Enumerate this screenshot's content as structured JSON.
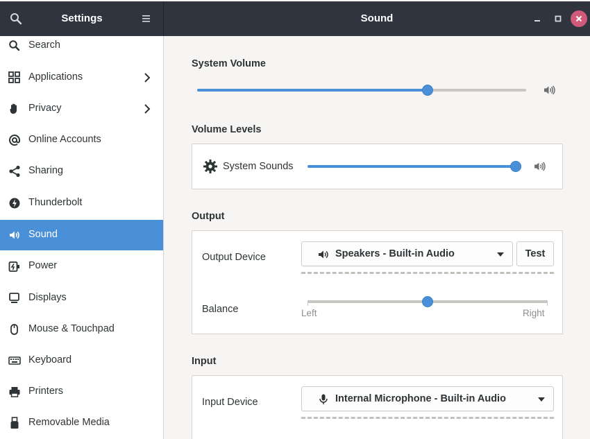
{
  "header": {
    "left_title": "Settings",
    "title": "Sound",
    "search_icon": "search-icon",
    "menu_icon": "hamburger-menu-icon",
    "window_controls": [
      "minimize-icon",
      "maximize-icon",
      "close-icon"
    ]
  },
  "sidebar": {
    "items": [
      {
        "label": "Search",
        "icon": "search-icon"
      },
      {
        "label": "Applications",
        "icon": "applications-grid-icon",
        "has_chevron": true
      },
      {
        "label": "Privacy",
        "icon": "hand-icon",
        "has_chevron": true
      },
      {
        "label": "Online Accounts",
        "icon": "at-sign-icon"
      },
      {
        "label": "Sharing",
        "icon": "share-icon"
      },
      {
        "label": "Thunderbolt",
        "icon": "thunderbolt-icon"
      },
      {
        "label": "Sound",
        "icon": "speaker-icon",
        "active": true
      },
      {
        "label": "Power",
        "icon": "power-icon"
      },
      {
        "label": "Displays",
        "icon": "display-icon"
      },
      {
        "label": "Mouse & Touchpad",
        "icon": "mouse-icon"
      },
      {
        "label": "Keyboard",
        "icon": "keyboard-icon"
      },
      {
        "label": "Printers",
        "icon": "printer-icon"
      },
      {
        "label": "Removable Media",
        "icon": "usb-icon"
      }
    ]
  },
  "main": {
    "system_volume": {
      "title": "System Volume",
      "level": 0.7,
      "icon": "volume-high-icon"
    },
    "volume_levels": {
      "title": "Volume Levels",
      "items": [
        {
          "label": "System Sounds",
          "icon": "gear-icon",
          "level": 1.0,
          "volume_icon": "volume-high-icon"
        }
      ]
    },
    "output": {
      "title": "Output",
      "device_label": "Output Device",
      "device_value": "Speakers - Built-in Audio",
      "device_icon": "speaker-icon",
      "test_label": "Test",
      "balance_label": "Balance",
      "balance_left": "Left",
      "balance_right": "Right",
      "balance_level": 0.5
    },
    "input": {
      "title": "Input",
      "device_label": "Input Device",
      "device_value": "Internal Microphone - Built-in Audio",
      "device_icon": "microphone-icon"
    }
  },
  "colors": {
    "accent": "#4a90d9",
    "headerbar": "#2f343f",
    "close_button": "#cf5a7a"
  }
}
